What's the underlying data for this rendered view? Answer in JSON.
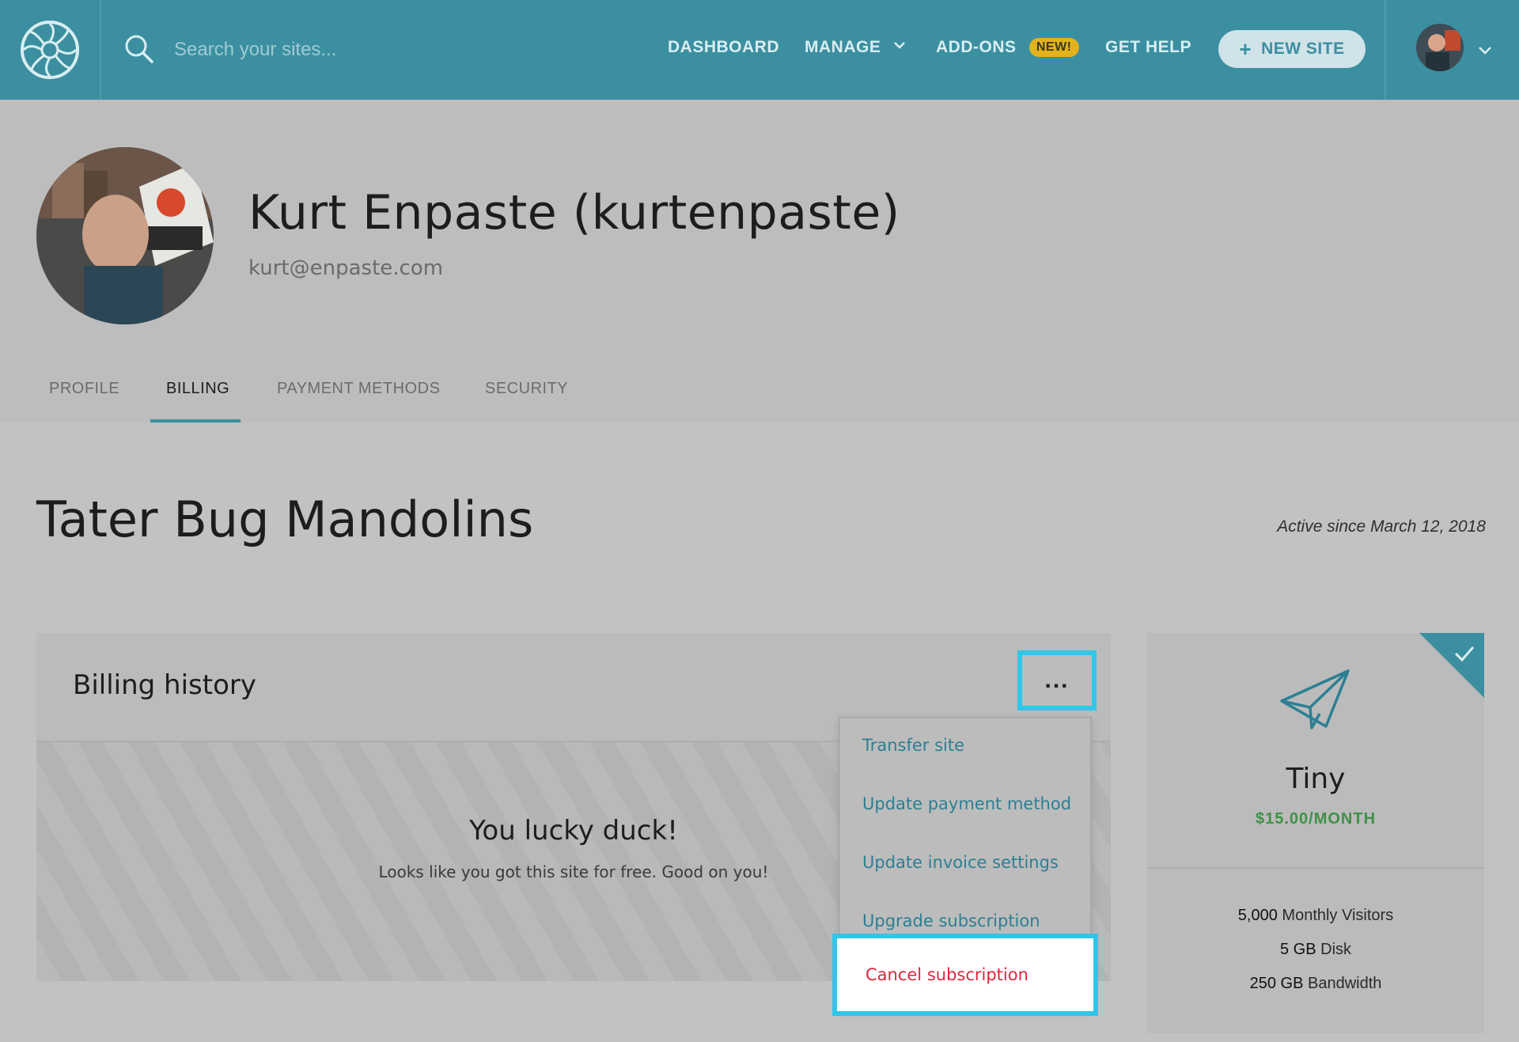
{
  "nav": {
    "search_placeholder": "Search your sites...",
    "links": {
      "dashboard": "DASHBOARD",
      "manage": "MANAGE",
      "addons": "ADD-ONS",
      "addons_badge": "NEW!",
      "help": "GET HELP"
    },
    "new_site_label": "NEW SITE",
    "colors": {
      "bar": "#3b8fa0",
      "badge": "#e3b21d"
    }
  },
  "profile": {
    "name": "Kurt Enpaste (kurtenpaste)",
    "email": "kurt@enpaste.com",
    "tabs": [
      "PROFILE",
      "BILLING",
      "PAYMENT METHODS",
      "SECURITY"
    ],
    "active_tab": "BILLING"
  },
  "site": {
    "title": "Tater Bug Mandolins",
    "active_since": "Active since March 12, 2018"
  },
  "billing": {
    "title": "Billing history",
    "more_label": "...",
    "empty_title": "You lucky duck!",
    "empty_text": "Looks like you got this site for free. Good on you!"
  },
  "menu": {
    "items": [
      "Transfer site",
      "Update payment method",
      "Update invoice settings",
      "Upgrade subscription"
    ],
    "cancel": "Cancel subscription",
    "colors": {
      "link": "#2c7f93",
      "danger": "#e0243c",
      "highlight": "#2fc6ea"
    }
  },
  "plan": {
    "name": "Tiny",
    "price": "$15.00/MONTH",
    "features": [
      {
        "value": "5,000",
        "label": "Monthly Visitors"
      },
      {
        "value": "5 GB",
        "label": "Disk"
      },
      {
        "value": "250 GB",
        "label": "Bandwidth"
      }
    ],
    "icon": "paper-plane-icon"
  }
}
